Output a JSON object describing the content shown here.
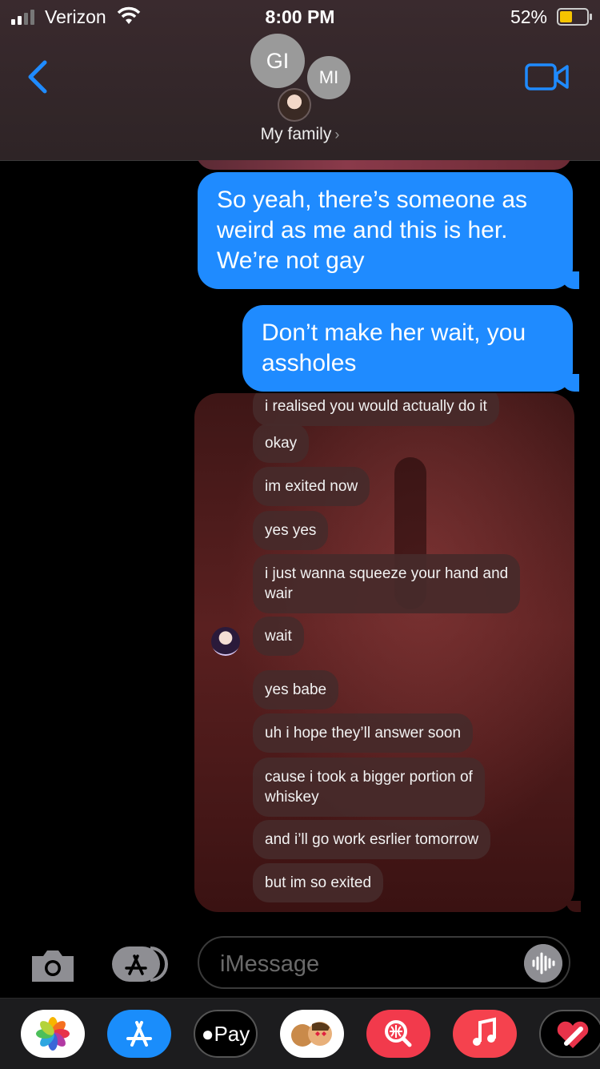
{
  "status_bar": {
    "carrier": "Verizon",
    "time": "8:00 PM",
    "battery_percent": "52%",
    "battery_level": 0.52,
    "signal_bars_active": 2,
    "signal_bars_total": 4
  },
  "header": {
    "back_icon": "chevron-left-icon",
    "video_icon": "video-camera-icon",
    "avatars": [
      "GI",
      "MI"
    ],
    "group_name": "My family",
    "accent_color": "#1f8bff"
  },
  "messages": [
    {
      "direction": "outgoing",
      "text": "So yeah, there’s someone as weird as me and this is her. We’re not gay"
    },
    {
      "direction": "outgoing",
      "text": "Don’t make her wait, you assholes"
    }
  ],
  "screenshot_message": {
    "bubbles": [
      "i realised you would actually do it",
      "okay",
      "im exited now",
      "yes yes",
      "i just wanna squeeze your hand and\nwair",
      "wait",
      "yes babe",
      "uh i hope they’ll answer soon",
      "cause i took a bigger portion of\nwhiskey",
      "and i’ll go work esrlier tomorrow",
      "but im so exited"
    ]
  },
  "input_bar": {
    "camera_icon": "camera-icon",
    "apps_icon": "app-store-icon",
    "placeholder": "iMessage",
    "audio_icon": "audio-waveform-icon"
  },
  "app_drawer": {
    "apps": [
      "photos-icon",
      "app-store-icon",
      "Pay",
      "memoji-icon",
      "web-search-icon",
      "music-icon",
      "heart-sticker-icon"
    ],
    "pay_label": "Pay"
  }
}
